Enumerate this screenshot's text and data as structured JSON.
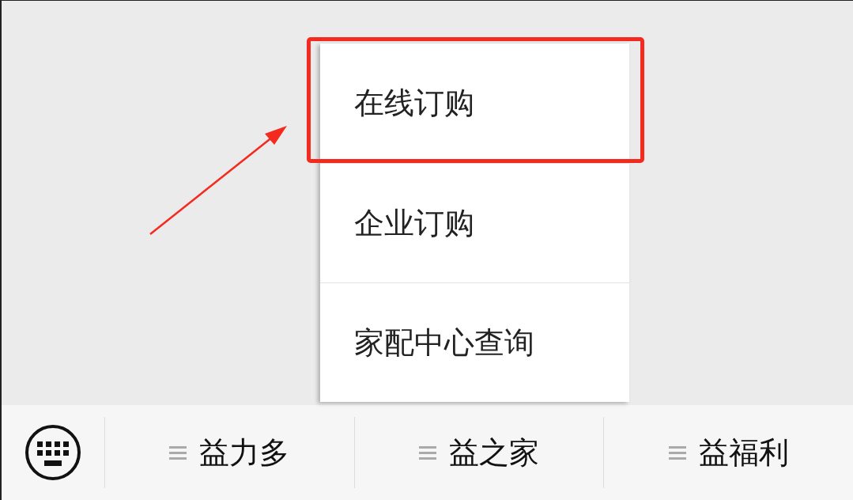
{
  "popup_menu": {
    "items": [
      {
        "label": "在线订购",
        "highlighted": true
      },
      {
        "label": "企业订购",
        "highlighted": false
      },
      {
        "label": "家配中心查询",
        "highlighted": false
      }
    ]
  },
  "bottom_menu": {
    "items": [
      {
        "label": "益力多"
      },
      {
        "label": "益之家"
      },
      {
        "label": "益福利"
      }
    ]
  }
}
